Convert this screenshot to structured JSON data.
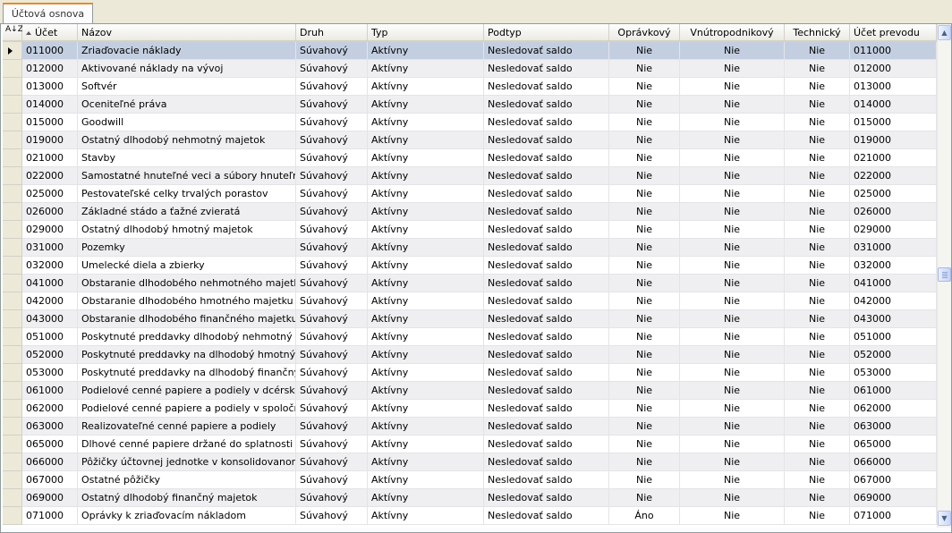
{
  "tab": {
    "label": "Účtová osnova"
  },
  "grid": {
    "sort_icon_text": "A↓Z",
    "columns": [
      {
        "key": "ucet",
        "label": "Účet",
        "sorted": "asc"
      },
      {
        "key": "nazov",
        "label": "Názov"
      },
      {
        "key": "druh",
        "label": "Druh"
      },
      {
        "key": "typ",
        "label": "Typ"
      },
      {
        "key": "podtyp",
        "label": "Podtyp"
      },
      {
        "key": "opravkovy",
        "label": "Oprávkový"
      },
      {
        "key": "vnutro",
        "label": "Vnútropodnikový"
      },
      {
        "key": "technicky",
        "label": "Technický"
      },
      {
        "key": "ucet_prevodu",
        "label": "Účet prevodu"
      }
    ],
    "selected_row": 0,
    "rows": [
      [
        "011000",
        "Zriaďovacie náklady",
        "Súvahový",
        "Aktívny",
        "Nesledovať saldo",
        "Nie",
        "Nie",
        "Nie",
        "011000"
      ],
      [
        "012000",
        "Aktivované náklady na vývoj",
        "Súvahový",
        "Aktívny",
        "Nesledovať saldo",
        "Nie",
        "Nie",
        "Nie",
        "012000"
      ],
      [
        "013000",
        "Softvér",
        "Súvahový",
        "Aktívny",
        "Nesledovať saldo",
        "Nie",
        "Nie",
        "Nie",
        "013000"
      ],
      [
        "014000",
        "Oceniteľné práva",
        "Súvahový",
        "Aktívny",
        "Nesledovať saldo",
        "Nie",
        "Nie",
        "Nie",
        "014000"
      ],
      [
        "015000",
        "Goodwill",
        "Súvahový",
        "Aktívny",
        "Nesledovať saldo",
        "Nie",
        "Nie",
        "Nie",
        "015000"
      ],
      [
        "019000",
        "Ostatný dlhodobý nehmotný majetok",
        "Súvahový",
        "Aktívny",
        "Nesledovať saldo",
        "Nie",
        "Nie",
        "Nie",
        "019000"
      ],
      [
        "021000",
        "Stavby",
        "Súvahový",
        "Aktívny",
        "Nesledovať saldo",
        "Nie",
        "Nie",
        "Nie",
        "021000"
      ],
      [
        "022000",
        "Samostatné hnuteľné veci a súbory hnuteľných ve",
        "Súvahový",
        "Aktívny",
        "Nesledovať saldo",
        "Nie",
        "Nie",
        "Nie",
        "022000"
      ],
      [
        "025000",
        "Pestovateľské celky trvalých porastov",
        "Súvahový",
        "Aktívny",
        "Nesledovať saldo",
        "Nie",
        "Nie",
        "Nie",
        "025000"
      ],
      [
        "026000",
        "Základné stádo a ťažné zvieratá",
        "Súvahový",
        "Aktívny",
        "Nesledovať saldo",
        "Nie",
        "Nie",
        "Nie",
        "026000"
      ],
      [
        "029000",
        "Ostatný dlhodobý hmotný majetok",
        "Súvahový",
        "Aktívny",
        "Nesledovať saldo",
        "Nie",
        "Nie",
        "Nie",
        "029000"
      ],
      [
        "031000",
        "Pozemky",
        "Súvahový",
        "Aktívny",
        "Nesledovať saldo",
        "Nie",
        "Nie",
        "Nie",
        "031000"
      ],
      [
        "032000",
        "Umelecké diela a zbierky",
        "Súvahový",
        "Aktívny",
        "Nesledovať saldo",
        "Nie",
        "Nie",
        "Nie",
        "032000"
      ],
      [
        "041000",
        "Obstaranie dlhodobého nehmotného majetku",
        "Súvahový",
        "Aktívny",
        "Nesledovať saldo",
        "Nie",
        "Nie",
        "Nie",
        "041000"
      ],
      [
        "042000",
        "Obstaranie dlhodobého hmotného majetku",
        "Súvahový",
        "Aktívny",
        "Nesledovať saldo",
        "Nie",
        "Nie",
        "Nie",
        "042000"
      ],
      [
        "043000",
        "Obstaranie dlhodobého finančného majetku",
        "Súvahový",
        "Aktívny",
        "Nesledovať saldo",
        "Nie",
        "Nie",
        "Nie",
        "043000"
      ],
      [
        "051000",
        "Poskytnuté preddavky dlhodobý nehmotný majetok",
        "Súvahový",
        "Aktívny",
        "Nesledovať saldo",
        "Nie",
        "Nie",
        "Nie",
        "051000"
      ],
      [
        "052000",
        "Poskytnuté preddavky na dlhodobý hmotný majetok",
        "Súvahový",
        "Aktívny",
        "Nesledovať saldo",
        "Nie",
        "Nie",
        "Nie",
        "052000"
      ],
      [
        "053000",
        "Poskytnuté preddavky na dlhodobý finančný majetok",
        "Súvahový",
        "Aktívny",
        "Nesledovať saldo",
        "Nie",
        "Nie",
        "Nie",
        "053000"
      ],
      [
        "061000",
        "Podielové cenné papiere a podiely v dcérskej účtovnej jednotke",
        "Súvahový",
        "Aktívny",
        "Nesledovať saldo",
        "Nie",
        "Nie",
        "Nie",
        "061000"
      ],
      [
        "062000",
        "Podielové cenné papiere a podiely v spoločnosti s podstatným vplyvom",
        "Súvahový",
        "Aktívny",
        "Nesledovať saldo",
        "Nie",
        "Nie",
        "Nie",
        "062000"
      ],
      [
        "063000",
        "Realizovateľné cenné papiere a podiely",
        "Súvahový",
        "Aktívny",
        "Nesledovať saldo",
        "Nie",
        "Nie",
        "Nie",
        "063000"
      ],
      [
        "065000",
        "Dlhové cenné papiere držané do splatnosti",
        "Súvahový",
        "Aktívny",
        "Nesledovať saldo",
        "Nie",
        "Nie",
        "Nie",
        "065000"
      ],
      [
        "066000",
        "Pôžičky účtovnej jednotke v konsolidovanom celku",
        "Súvahový",
        "Aktívny",
        "Nesledovať saldo",
        "Nie",
        "Nie",
        "Nie",
        "066000"
      ],
      [
        "067000",
        "Ostatné pôžičky",
        "Súvahový",
        "Aktívny",
        "Nesledovať saldo",
        "Nie",
        "Nie",
        "Nie",
        "067000"
      ],
      [
        "069000",
        "Ostatný dlhodobý finančný majetok",
        "Súvahový",
        "Aktívny",
        "Nesledovať saldo",
        "Nie",
        "Nie",
        "Nie",
        "069000"
      ],
      [
        "071000",
        "Oprávky k zriaďovacím nákladom",
        "Súvahový",
        "Aktívny",
        "Nesledovať saldo",
        "Áno",
        "Nie",
        "Nie",
        "071000"
      ]
    ]
  },
  "scrollbar": {
    "up_icon": "▲",
    "down_icon": "▼"
  }
}
